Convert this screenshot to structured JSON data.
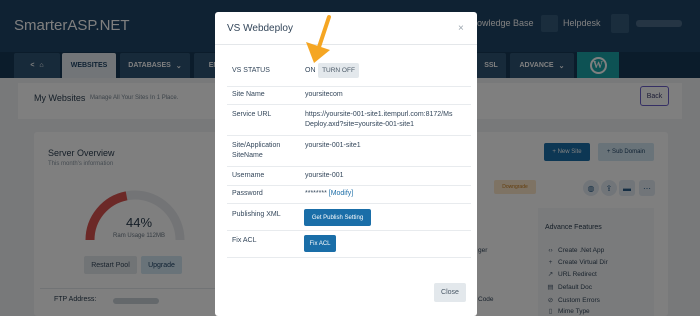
{
  "brand": "SmarterASP.NET",
  "header": {
    "kb_label": "owledge Base",
    "helpdesk_label": "Helpdesk"
  },
  "nav": {
    "home_chevron": "<",
    "websites": "WEBSITES",
    "databases": "DATABASES",
    "emails_fragment": "EM",
    "ssl": "SSL",
    "advance": "ADVANCE"
  },
  "page": {
    "title": "My Websites",
    "subtitle": "Manage All Your Sites In 1 Place.",
    "back_label": "Back"
  },
  "server_overview": {
    "title": "Server Overview",
    "subtitle": "This month's information",
    "ram_percent_text": "44%",
    "ram_percent": 44,
    "ram_label": "Ram Usage 112MB",
    "restart_label": "Restart Pool",
    "upgrade_label": "Upgrade",
    "ftp_label": "FTP Address:"
  },
  "actions": {
    "new_site": "+ New Site",
    "sub_domain": "+ Sub Domain",
    "downgrade": "Downgrade"
  },
  "partial_items": {
    "ger": "ger",
    "code": "Code"
  },
  "advance_features": {
    "title": "Advance Features",
    "items": [
      {
        "icon": "code-icon",
        "label": "Create .Net App"
      },
      {
        "icon": "add-icon",
        "label": "Create Virtual Dir"
      },
      {
        "icon": "redirect-icon",
        "label": "URL Redirect"
      },
      {
        "icon": "doc-icon",
        "label": "Default Doc"
      },
      {
        "icon": "warning-icon",
        "label": "Custom Errors"
      },
      {
        "icon": "file-icon",
        "label": "Mime Type"
      }
    ]
  },
  "modal": {
    "title": "VS Webdeploy",
    "close_glyph": "×",
    "vs_status_label": "VS STATUS",
    "vs_status_value": "ON",
    "turn_off_label": "TURN OFF",
    "site_name_label": "Site Name",
    "site_name_value": "yoursitecom",
    "service_url_label": "Service URL",
    "service_url_line1": "https://yoursite-001-site1.itempurl.com:8172/Ms",
    "service_url_line2": "Deploy.axd?site=yoursite-001-site1",
    "app_sitename_label_line1": "Site/Application",
    "app_sitename_label_line2": "SiteName",
    "app_sitename_value": "yoursite-001-site1",
    "username_label": "Username",
    "username_value": "yoursite-001",
    "password_label": "Password",
    "password_value": "********",
    "modify_label": "[Modify]",
    "publishing_xml_label": "Publishing XML",
    "get_publish_setting": "Get Publish Setting",
    "fix_acl_label": "Fix ACL",
    "fix_acl_button": "Fix ACL",
    "close_button": "Close"
  },
  "colors": {
    "header_bg": "#1f4466",
    "primary": "#1a6ea8",
    "accent_teal": "#1aa5a9",
    "arrow": "#f5a623",
    "gauge_red": "#d9534f"
  }
}
